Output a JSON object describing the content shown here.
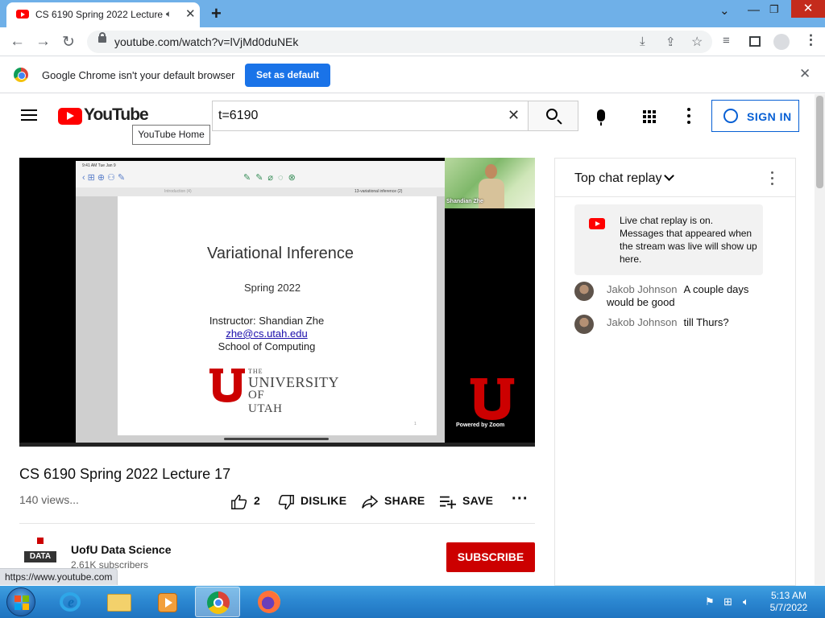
{
  "browser": {
    "tab_title": "CS 6190 Spring 2022 Lecture",
    "tab_audio_icon": "speaker-icon",
    "url": "youtube.com/watch?v=lVjMd0duNEk",
    "infobar_text": "Google Chrome isn't your default browser",
    "infobar_button": "Set as default",
    "status_url": "https://www.youtube.com"
  },
  "youtube": {
    "logo_text": "YouTube",
    "tooltip": "YouTube Home",
    "search_value": "t=6190",
    "sign_in_label": "SIGN IN"
  },
  "video": {
    "ipad_status": "9:41 AM   Tue Jan 9",
    "ipad_tab_left": "Introduction (4)",
    "ipad_tab_right": "13-variational inference (2)",
    "slide_title": "Variational Inference",
    "slide_subtitle": "Spring 2022",
    "slide_instructor": "Instructor: Shandian Zhe",
    "slide_email": "zhe@cs.utah.edu",
    "slide_school": "School of Computing",
    "utah_the": "THE",
    "utah_university": "UNIVERSITY",
    "utah_of": "OF UTAH",
    "slide_page": "1",
    "cam_name": "Shandian Zhe",
    "zoom_powered": "Powered by Zoom"
  },
  "chat": {
    "title": "Top chat replay",
    "banner": "Live chat replay is on. Messages that appeared when the stream was live will show up here.",
    "messages": [
      {
        "author": "Jakob Johnson",
        "text": "A couple days would be good"
      },
      {
        "author": "Jakob Johnson",
        "text": "till Thurs?"
      }
    ]
  },
  "details": {
    "title": "CS 6190 Spring 2022 Lecture 17",
    "views": "140 views...",
    "likes": "2",
    "dislike_label": "DISLIKE",
    "share_label": "SHARE",
    "save_label": "SAVE",
    "channel_name": "UofU Data Science",
    "channel_avatar_text": "DATA",
    "subscribers": "2.61K subscribers",
    "subscribe_label": "SUBSCRIBE"
  },
  "taskbar": {
    "time": "5:13 AM",
    "date": "5/7/2022"
  },
  "colors": {
    "youtube_red": "#ff0000",
    "subscribe_red": "#cc0000",
    "link_blue": "#065fd4",
    "chrome_blue": "#1a73e8",
    "utah_red": "#cc0000"
  }
}
